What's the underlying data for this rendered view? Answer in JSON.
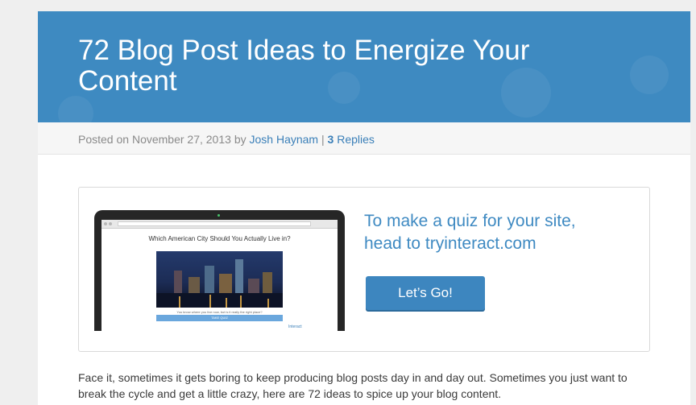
{
  "post": {
    "title": "72 Blog Post Ideas to Energize Your Content",
    "meta": {
      "posted_on_label": "Posted on",
      "date": "November 27, 2013",
      "by_label": "by",
      "author": "Josh Haynam",
      "separator": "|",
      "replies_count": "3",
      "replies_label": "Replies"
    },
    "intro": "Face it, sometimes it gets boring to keep producing blog posts day in and day out. Sometimes you just want to break the cycle and get a little crazy, here are 72 ideas to spice up your blog content."
  },
  "banner": {
    "laptop_screen": {
      "quiz_title": "Which American City Should You Actually Live in?",
      "quiz_question": "You know where you live now, but is it really the right place?",
      "take_quiz_label": "TAKE QUIZ",
      "brand": "Interact"
    },
    "cta_line1": "To make a quiz for your site,",
    "cta_line2": "head to tryinteract.com",
    "button_label": "Let’s Go!"
  },
  "colors": {
    "header_blue": "#3e8ac1",
    "link_blue": "#3a7fb8",
    "cta_blue": "#3d86bf"
  }
}
